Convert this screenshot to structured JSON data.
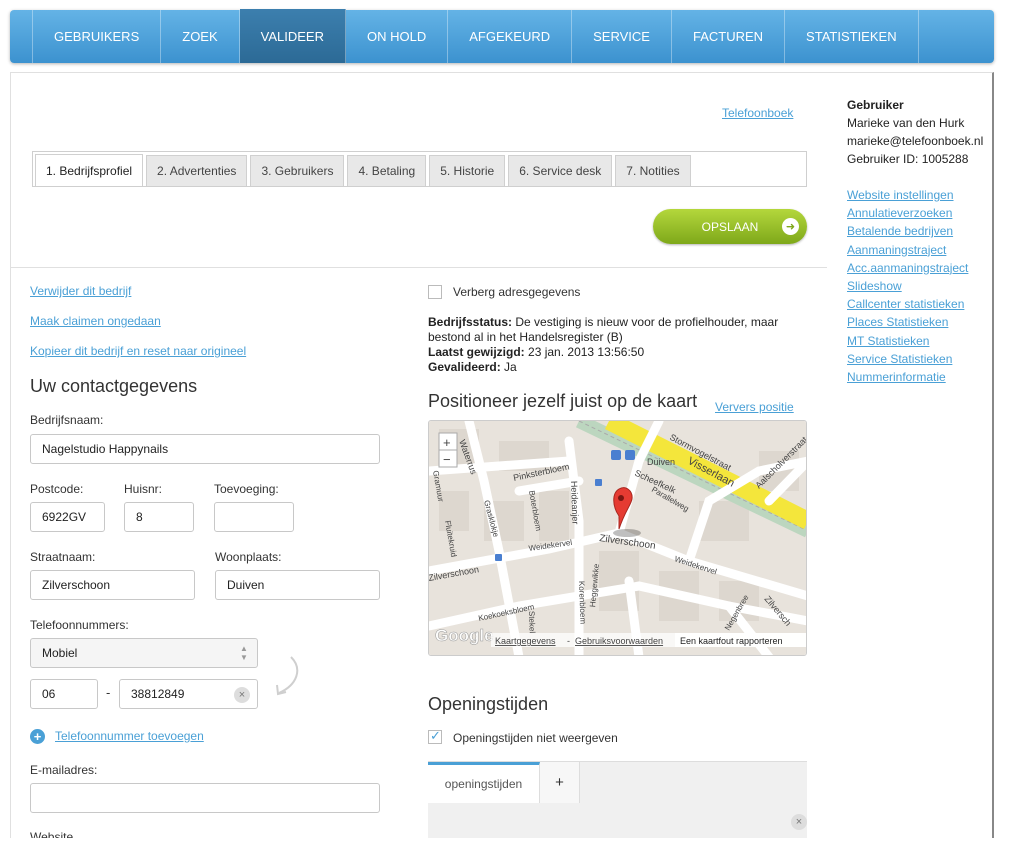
{
  "topnav": {
    "items": [
      "GEBRUIKERS",
      "ZOEK",
      "VALIDEER",
      "ON HOLD",
      "AFGEKEURD",
      "SERVICE",
      "FACTUREN",
      "STATISTIEKEN"
    ],
    "active_index": 2
  },
  "header": {
    "telefoonboek_link": "Telefoonboek"
  },
  "subtabs": [
    "1. Bedrijfsprofiel",
    "2. Advertenties",
    "3. Gebruikers",
    "4. Betaling",
    "5. Historie",
    "6. Service desk",
    "7. Notities"
  ],
  "save_button": "OPSLAAN",
  "left": {
    "links": [
      "Verwijder dit bedrijf",
      "Maak claimen ongedaan",
      "Kopieer dit bedrijf en reset naar origineel"
    ],
    "section_title": "Uw contactgegevens",
    "bedrijfsnaam_label": "Bedrijfsnaam:",
    "bedrijfsnaam_value": "Nagelstudio Happynails",
    "postcode_label": "Postcode:",
    "postcode_value": "6922GV",
    "huisnr_label": "Huisnr:",
    "huisnr_value": "8",
    "toevoeging_label": "Toevoeging:",
    "toevoeging_value": "",
    "straatnaam_label": "Straatnaam:",
    "straatnaam_value": "Zilverschoon",
    "woonplaats_label": "Woonplaats:",
    "woonplaats_value": "Duiven",
    "telefoon_label": "Telefoonnummers:",
    "telefoon_type": "Mobiel",
    "telefoon_prefix": "06",
    "telefoon_separator": "-",
    "telefoon_number": "38812849",
    "add_phone_link": "Telefoonnummer toevoegen",
    "email_label": "E-mailadres:",
    "email_value": "",
    "website_label": "Website"
  },
  "middle": {
    "hide_address_label": "Verberg adresgegevens",
    "status_label": "Bedrijfsstatus:",
    "status_text": "De vestiging is nieuw voor de profielhouder, maar bestond al in het Handelsregister (B)",
    "modified_label": "Laatst gewijzigd:",
    "modified_value": "23 jan. 2013 13:56:50",
    "validated_label": "Gevalideerd:",
    "validated_value": "Ja",
    "map_title": "Positioneer jezelf juist op de kaart",
    "refresh_link": "Ververs positie",
    "map": {
      "zoom_in": "+",
      "zoom_out": "−",
      "streets": [
        "Stormvogelstraat",
        "Duiven",
        "Visserlaan",
        "Aalscholverstraat",
        "Waterrus",
        "Pinksterbloem",
        "Scheefkelk",
        "Parallelweg",
        "Heideanjer",
        "Boterbloem",
        "Grasklokje",
        "Fluitekruid",
        "Gramuur",
        "Zilverschoon",
        "Weidekervel",
        "Zilverschoon",
        "Weidekervel",
        "Koekoeksbloem",
        "Korenbloem",
        "Heggewikke",
        "Negenbree",
        "Zilversch",
        "Stekel"
      ],
      "footer_data": "Kaartgegevens",
      "footer_sep": "-",
      "footer_terms": "Gebruiksvoorwaarden",
      "footer_report": "Een kaartfout rapporteren",
      "logo": "Google"
    },
    "hours_title": "Openingstijden",
    "hours_hide_label": "Openingstijden niet weergeven",
    "hours_tab": "openingstijden",
    "hours_add": "+",
    "close_symbol": "×"
  },
  "sidebar": {
    "title": "Gebruiker",
    "name": "Marieke van den Hurk",
    "email": "marieke@telefoonboek.nl",
    "user_id": "Gebruiker ID: 1005288",
    "links": [
      "Website instellingen",
      "Annulatieverzoeken",
      "Betalende bedrijven",
      "Aanmaningstraject",
      "Acc.aanmaningstraject",
      "Slideshow",
      "Callcenter statistieken",
      "Places Statistieken",
      "MT Statistieken",
      "Service Statistieken",
      "Nummerinformatie"
    ]
  },
  "colors": {
    "nav": "#4aa3dc",
    "nav_active": "#3277a5",
    "link": "#4aa0d6",
    "save": "#94c12a"
  }
}
